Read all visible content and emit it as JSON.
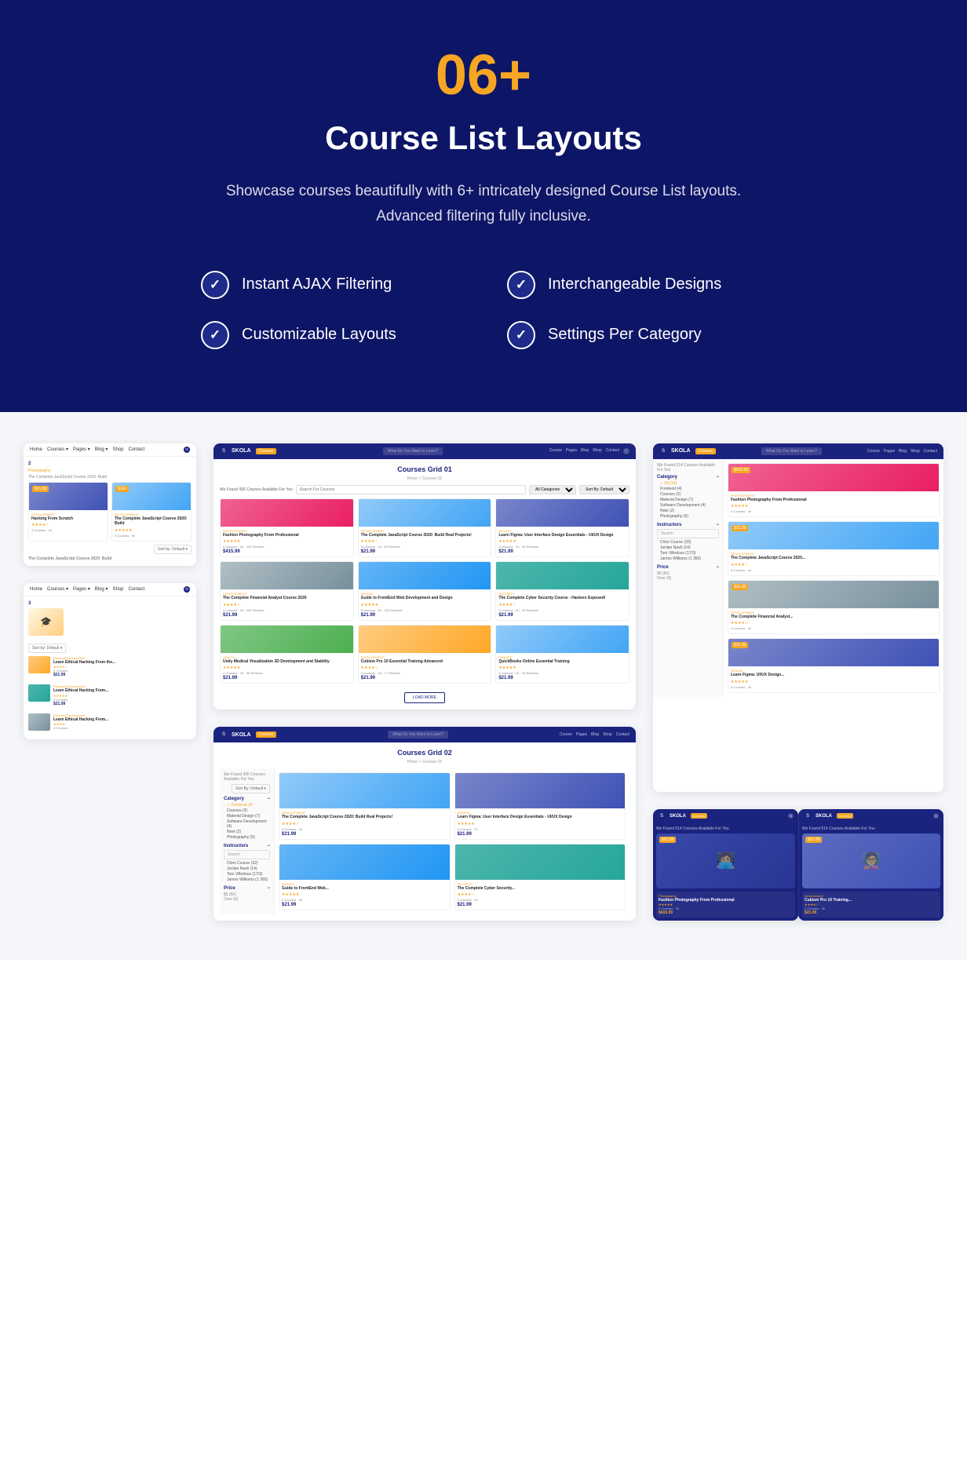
{
  "hero": {
    "number": "06+",
    "title": "Course List Layouts",
    "description": "Showcase courses beautifully with 6+ intricately designed Course List layouts. Advanced filtering fully inclusive.",
    "features": [
      {
        "id": "ajax",
        "label": "Instant AJAX Filtering"
      },
      {
        "id": "interchangeable",
        "label": "Interchangeable Designs"
      },
      {
        "id": "customizable",
        "label": "Customizable Layouts"
      },
      {
        "id": "settings",
        "label": "Settings Per Category"
      }
    ]
  },
  "screenshots": {
    "left": [
      {
        "id": "left-top",
        "number": "2",
        "sort_label": "Sort By: Default",
        "courses": [
          {
            "img_class": "img-person1",
            "name": "Hacking From Scratch",
            "price": "$21.99",
            "cat": "Development"
          },
          {
            "img_class": "img-comp1",
            "name": "The Complete JavaScript Course 2020: Build",
            "price": "$100",
            "cat": "Development"
          }
        ]
      },
      {
        "id": "left-bottom",
        "number": "3",
        "sort_label": "Sort By: Default",
        "courses": [
          {
            "img_class": "img-desk2",
            "cat": "Personal Development",
            "name": "Learn Ethical Hacking From the...",
            "price": "$21.99"
          },
          {
            "img_class": "img-person2",
            "cat": "Personal Development",
            "name": "Learn Ethical Hacking From...",
            "price": "$21.99"
          },
          {
            "img_class": "img-desk1",
            "cat": "Personal Development",
            "name": "Learn Ethical Hacking From...",
            "price": ""
          }
        ]
      }
    ],
    "center_top": {
      "id": "courses-grid-01",
      "title": "Courses Grid 01",
      "breadcrumb": "Home > Courses 01",
      "found_text": "We Found 436 Courses Available For You",
      "search_placeholder": "Search For Courses",
      "filter_category": "All Categories",
      "filter_sort": "Sort By: Default",
      "courses": [
        {
          "img_class": "img-person4",
          "cat": "Photography",
          "name": "Fashion Photography From Professional",
          "price": "$415.99",
          "rating": "★★★★★",
          "meta": "4 Lessons · 2h"
        },
        {
          "img_class": "img-comp1",
          "cat": "Development",
          "name": "The Complete JavaScript Course 2020: Build Real Projects!",
          "price": "$21.99",
          "rating": "★★★★☆",
          "meta": "5 Lessons · 4h"
        },
        {
          "img_class": "img-person1",
          "cat": "Design",
          "name": "Learn Figma: User Interface Design Essentials - UI/UX Design",
          "price": "$21.99",
          "rating": "★★★★★",
          "meta": "3 Lessons · 2h"
        },
        {
          "img_class": "img-desk1",
          "cat": "Development",
          "name": "The Complete Financial Analyst Course 2020",
          "price": "$21.99",
          "rating": "★★★★☆",
          "meta": "4 Lessons · 3h"
        },
        {
          "img_class": "img-person5",
          "cat": "Design",
          "name": "Guide to FrontEnd Web Development and Design",
          "price": "$21.99",
          "rating": "★★★★★",
          "meta": "5 Lessons · 5h"
        },
        {
          "img_class": "img-person2",
          "cat": "Security",
          "name": "The Complete Cyber Security Course - Hackers Exposed!",
          "price": "$21.99",
          "rating": "★★★★☆",
          "meta": "3 Lessons · 2h"
        },
        {
          "img_class": "img-person6",
          "cat": "Health",
          "name": "Unity Medical Visualization 3D Development and Stability",
          "price": "$21.99",
          "rating": "★★★★★",
          "meta": "4 Lessons · 4h"
        },
        {
          "img_class": "img-desk2",
          "cat": "Development",
          "name": "Cubism Pro 10 Essential Training Advanced",
          "price": "$21.99",
          "rating": "★★★★☆",
          "meta": "4 Lessons · 3h"
        },
        {
          "img_class": "img-comp1",
          "cat": "Finance",
          "name": "QuickBooks Online Essential Training",
          "price": "$21.99",
          "rating": "★★★★★",
          "meta": "3 Lessons · 2h"
        }
      ],
      "load_more": "LOAD MORE"
    },
    "center_bottom": {
      "id": "courses-grid-02",
      "title": "Courses Grid 02",
      "breadcrumb": "Home > Courses 02",
      "found_text": "We Found 436 Courses Available For You",
      "filter_sort": "Sort By: Default",
      "sidebar": {
        "category_label": "Category",
        "categories": [
          "Frontend (4)",
          "Courses (3)",
          "Material Design (7)",
          "Software Development (4)",
          "Note (2)",
          "Photography (5)"
        ],
        "instructors_label": "Instructors",
        "instructors": [
          "Search",
          "Chris Course (32)",
          "Jordan Nash (14)",
          "Tom Villedoux (17/3)",
          "James Williams (1 350)"
        ],
        "price_label": "Price",
        "price_range": "$0 - $50"
      },
      "courses": [
        {
          "img_class": "img-comp1",
          "cat": "Development",
          "name": "The Complete JavaScript Course 2020: Build Real Projects!",
          "price": "$21.99",
          "rating": "★★★★☆"
        },
        {
          "img_class": "img-person1",
          "cat": "Design",
          "name": "Learn Figma: User Interface Design Essentials - UI/UX Design",
          "price": "$21.99",
          "rating": "★★★★★"
        },
        {
          "img_class": "img-person5",
          "cat": "Design",
          "name": "Guide to FrontEnd Web...",
          "price": "$21.99",
          "rating": "★★★★★"
        },
        {
          "img_class": "img-person2",
          "cat": "Security",
          "name": "The Complete Cyber Secur...",
          "price": "$21.99",
          "rating": "★★★★☆"
        }
      ]
    },
    "right_top": {
      "id": "courses-sidebar-01",
      "found_text": "We Found 514 Courses Available For You",
      "sidebar": {
        "category_label": "Category",
        "categories": [
          "All (15)",
          "Frontend (4)",
          "Courses (3)",
          "Material Design (7)",
          "Software Development (4)",
          "Note (2)",
          "Photography (5)"
        ],
        "instructors_label": "Instructors",
        "search_placeholder": "Search",
        "instructors": [
          "Chris Course (32)",
          "Jordan Nash (14)",
          "Tom Villedoux (17/3)",
          "James Williams (1 350)"
        ],
        "price_label": "Price",
        "price_range1": "$0 (50)",
        "price_range2": "Over (6)"
      },
      "courses": [
        {
          "img_class": "img-person4",
          "cat": "Photography",
          "name": "Fashion Photography From Professional",
          "price": "$415.99",
          "rating": "★★★★★"
        },
        {
          "img_class": "img-comp1",
          "cat": "Development",
          "name": "The Complete JavaScript Course 2020...",
          "price": "$21.99",
          "rating": "★★★★☆"
        },
        {
          "img_class": "img-desk1",
          "cat": "Development",
          "name": "The Complete Financial Analyst...",
          "price": "$21.99",
          "rating": "★★★★☆"
        },
        {
          "img_class": "img-person1",
          "cat": "Design",
          "name": "Learn Figma: UI/UX Design...",
          "price": "$21.99",
          "rating": "★★★★★"
        }
      ]
    },
    "right_bottom_left": {
      "id": "courses-dark-01",
      "img_class": "img-person3",
      "price": "$21.99",
      "courses": [
        {
          "img_class": "img-person4",
          "cat": "Photography",
          "name": "Fashion Photography From Professional",
          "price": "$415.99",
          "rating": "★★★★★"
        }
      ]
    },
    "right_bottom_right": {
      "id": "courses-dark-02",
      "img_class": "img-person5",
      "price": "$21.99",
      "courses": [
        {
          "img_class": "img-desk2",
          "cat": "Development",
          "name": "Cubism Pro 10 Training...",
          "price": "$21.99",
          "rating": "★★★★☆"
        }
      ]
    }
  },
  "colors": {
    "navy": "#0d1566",
    "dark_blue": "#1a237e",
    "gold": "#f5a623",
    "white": "#ffffff",
    "light_gray": "#f5f6fa"
  }
}
